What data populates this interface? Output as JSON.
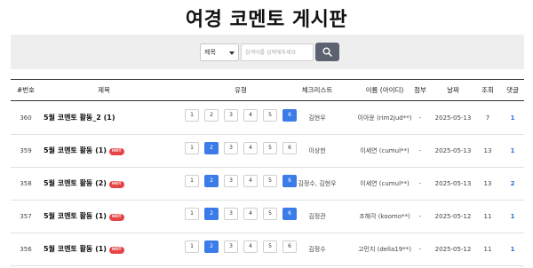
{
  "page": {
    "title": "여경 코멘토 게시판"
  },
  "search": {
    "select_value": "제목",
    "placeholder": "검색어를 입력해주세요"
  },
  "columns": [
    "#번호",
    "제목",
    "유형",
    "체크리스트",
    "이름 (아이디)",
    "첨부",
    "날짜",
    "조회",
    "댓글"
  ],
  "hot_label": "HOT",
  "pagination_labels": [
    "1",
    "2",
    "3",
    "4",
    "5",
    "6"
  ],
  "rows": [
    {
      "no": "360",
      "subject": "5월 코멘토 활동_2 (1)",
      "hot": false,
      "active_pages": [
        "6"
      ],
      "checklist": "김현우",
      "author": "이아윤 (rim2jud**)",
      "attach": "-",
      "date": "2025-05-13",
      "views": "7",
      "replies": "1"
    },
    {
      "no": "359",
      "subject": "5월 코멘토 활동 (1)",
      "hot": true,
      "active_pages": [
        "2"
      ],
      "checklist": "이상헌",
      "author": "이세연 (cumul**)",
      "attach": "-",
      "date": "2025-05-13",
      "views": "13",
      "replies": "1"
    },
    {
      "no": "358",
      "subject": "5월 코멘토 활동 (2)",
      "hot": true,
      "active_pages": [
        "2",
        "6"
      ],
      "checklist": "김정수, 김현우",
      "author": "이세연 (cumul**)",
      "attach": "-",
      "date": "2025-05-13",
      "views": "13",
      "replies": "2"
    },
    {
      "no": "357",
      "subject": "5월 코멘토 활동 (1)",
      "hot": true,
      "active_pages": [
        "2",
        "6"
      ],
      "checklist": "김정관",
      "author": "조해각 (koomo**)",
      "attach": "-",
      "date": "2025-05-12",
      "views": "11",
      "replies": "1"
    },
    {
      "no": "356",
      "subject": "5월 코멘토 활동 (1)",
      "hot": true,
      "active_pages": [
        "2"
      ],
      "checklist": "김정수",
      "author": "고민지 (della19**)",
      "attach": "-",
      "date": "2025-05-12",
      "views": "11",
      "replies": "1"
    }
  ],
  "colors": {
    "accent": "#3b7ce9",
    "hot": "#e64545",
    "search_button": "#5c6270",
    "reply_link": "#2a6fd6"
  }
}
